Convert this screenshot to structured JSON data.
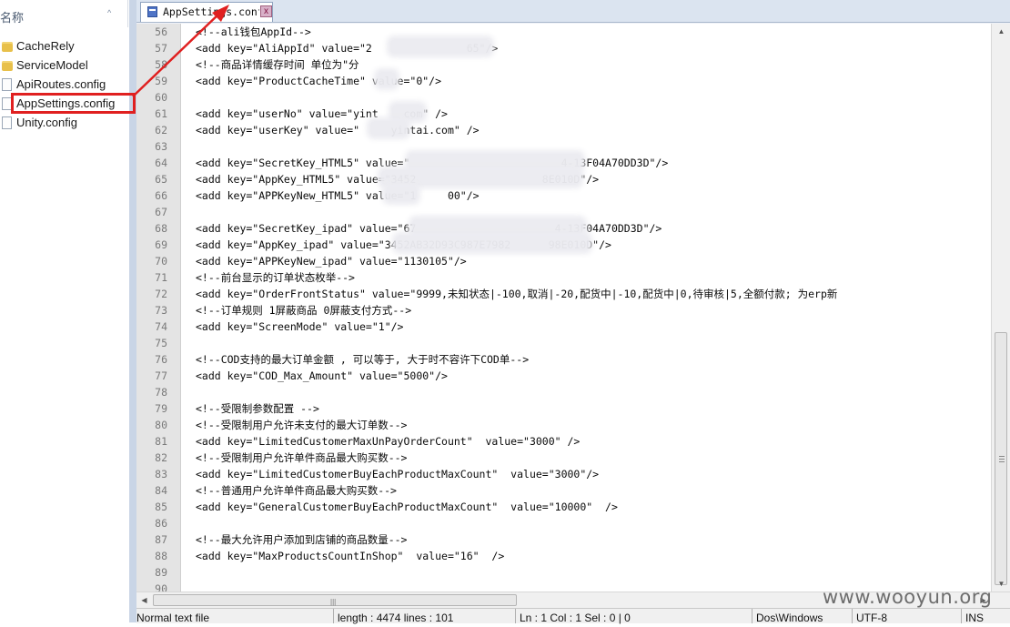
{
  "explorer": {
    "header_label": "名称",
    "items": [
      {
        "label": "CacheRely",
        "icon": "folder-icon"
      },
      {
        "label": "ServiceModel",
        "icon": "folder-icon"
      },
      {
        "label": "ApiRoutes.config",
        "icon": "config-file-icon"
      },
      {
        "label": "AppSettings.config",
        "icon": "config-file-icon"
      },
      {
        "label": "Unity.config",
        "icon": "config-file-icon"
      }
    ]
  },
  "annotation": {
    "color": "#e02020"
  },
  "editor": {
    "tab_label": "AppSettings.config",
    "tab_close": "x",
    "lines": [
      {
        "no": "56",
        "text": "<!--ali钱包AppId-->"
      },
      {
        "no": "57",
        "text": "<add key=\"AliAppId\" value=\"2               65\"/>"
      },
      {
        "no": "58",
        "text": "<!--商品详情缓存时间 单位为\"分"
      },
      {
        "no": "59",
        "text": "<add key=\"ProductCacheTime\" value=\"0\"/>"
      },
      {
        "no": "60",
        "text": ""
      },
      {
        "no": "61",
        "text": "<add key=\"userNo\" value=\"yint    com\" />"
      },
      {
        "no": "62",
        "text": "<add key=\"userKey\" value=\"     yintai.com\" />"
      },
      {
        "no": "63",
        "text": ""
      },
      {
        "no": "64",
        "text": "<add key=\"SecretKey_HTML5\" value=\"                        4-13F04A70DD3D\"/>"
      },
      {
        "no": "65",
        "text": "<add key=\"AppKey_HTML5\" value=\"3452                    8E010D\"/>"
      },
      {
        "no": "66",
        "text": "<add key=\"APPKeyNew_HTML5\" value=\"1     00\"/>"
      },
      {
        "no": "67",
        "text": ""
      },
      {
        "no": "68",
        "text": "<add key=\"SecretKey_ipad\" value=\"67                      4-13F04A70DD3D\"/>"
      },
      {
        "no": "69",
        "text": "<add key=\"AppKey_ipad\" value=\"3452AB32D93C987E7982      98E010D\"/>"
      },
      {
        "no": "70",
        "text": "<add key=\"APPKeyNew_ipad\" value=\"1130105\"/>"
      },
      {
        "no": "71",
        "text": "<!--前台显示的订单状态枚举-->"
      },
      {
        "no": "72",
        "text": "<add key=\"OrderFrontStatus\" value=\"9999,未知状态|-100,取消|-20,配货中|-10,配货中|0,待审核|5,全额付款; 为erp新"
      },
      {
        "no": "73",
        "text": "<!--订单规则 1屏蔽商品 0屏蔽支付方式-->"
      },
      {
        "no": "74",
        "text": "<add key=\"ScreenMode\" value=\"1\"/>"
      },
      {
        "no": "75",
        "text": ""
      },
      {
        "no": "76",
        "text": "<!--COD支持的最大订单金额 , 可以等于, 大于时不容许下COD单-->"
      },
      {
        "no": "77",
        "text": "<add key=\"COD_Max_Amount\" value=\"5000\"/>"
      },
      {
        "no": "78",
        "text": ""
      },
      {
        "no": "79",
        "text": "<!--受限制参数配置 -->"
      },
      {
        "no": "80",
        "text": "<!--受限制用户允许未支付的最大订单数-->"
      },
      {
        "no": "81",
        "text": "<add key=\"LimitedCustomerMaxUnPayOrderCount\"  value=\"3000\" />"
      },
      {
        "no": "82",
        "text": "<!--受限制用户允许单件商品最大购买数-->"
      },
      {
        "no": "83",
        "text": "<add key=\"LimitedCustomerBuyEachProductMaxCount\"  value=\"3000\"/>"
      },
      {
        "no": "84",
        "text": "<!--普通用户允许单件商品最大购买数-->"
      },
      {
        "no": "85",
        "text": "<add key=\"GeneralCustomerBuyEachProductMaxCount\"  value=\"10000\"  />"
      },
      {
        "no": "86",
        "text": ""
      },
      {
        "no": "87",
        "text": "<!--最大允许用户添加到店铺的商品数量-->"
      },
      {
        "no": "88",
        "text": "<add key=\"MaxProductsCountInShop\"  value=\"16\"  />"
      },
      {
        "no": "89",
        "text": ""
      },
      {
        "no": "90",
        "text": ""
      }
    ]
  },
  "statusbar": {
    "file_type": "Normal text file",
    "length": "length : 4474    lines : 101",
    "position": "Ln : 1    Col : 1    Sel : 0 | 0",
    "eol": "Dos\\Windows",
    "encoding": "UTF-8",
    "mode": "INS"
  },
  "watermark": "www.wooyun.org"
}
